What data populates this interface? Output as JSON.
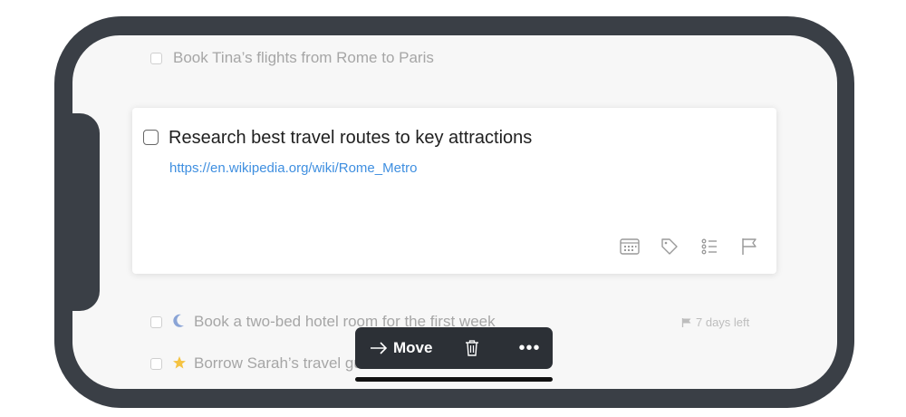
{
  "tasks": {
    "top": {
      "label": "Book Tina’s flights from Rome to Paris"
    },
    "focused": {
      "title": "Research best travel routes to key attractions",
      "link": "https://en.wikipedia.org/wiki/Rome_Metro",
      "tools": [
        "calendar-icon",
        "tag-icon",
        "checklist-icon",
        "flag-icon"
      ]
    },
    "hotel": {
      "label": "Book a two-bed hotel room for the first week",
      "deadline": "7 days left",
      "icon": "moon-icon"
    },
    "borrow": {
      "label": "Borrow Sarah’s travel guide",
      "icon": "star-icon"
    }
  },
  "toolbar": {
    "move_label": "Move",
    "more_label": "•••"
  },
  "colors": {
    "frame": "#3a3f46",
    "link": "#3f8fe0",
    "moon": "#8aa4d6",
    "star": "#f5c342",
    "toolbar_bg": "#2c3036"
  }
}
